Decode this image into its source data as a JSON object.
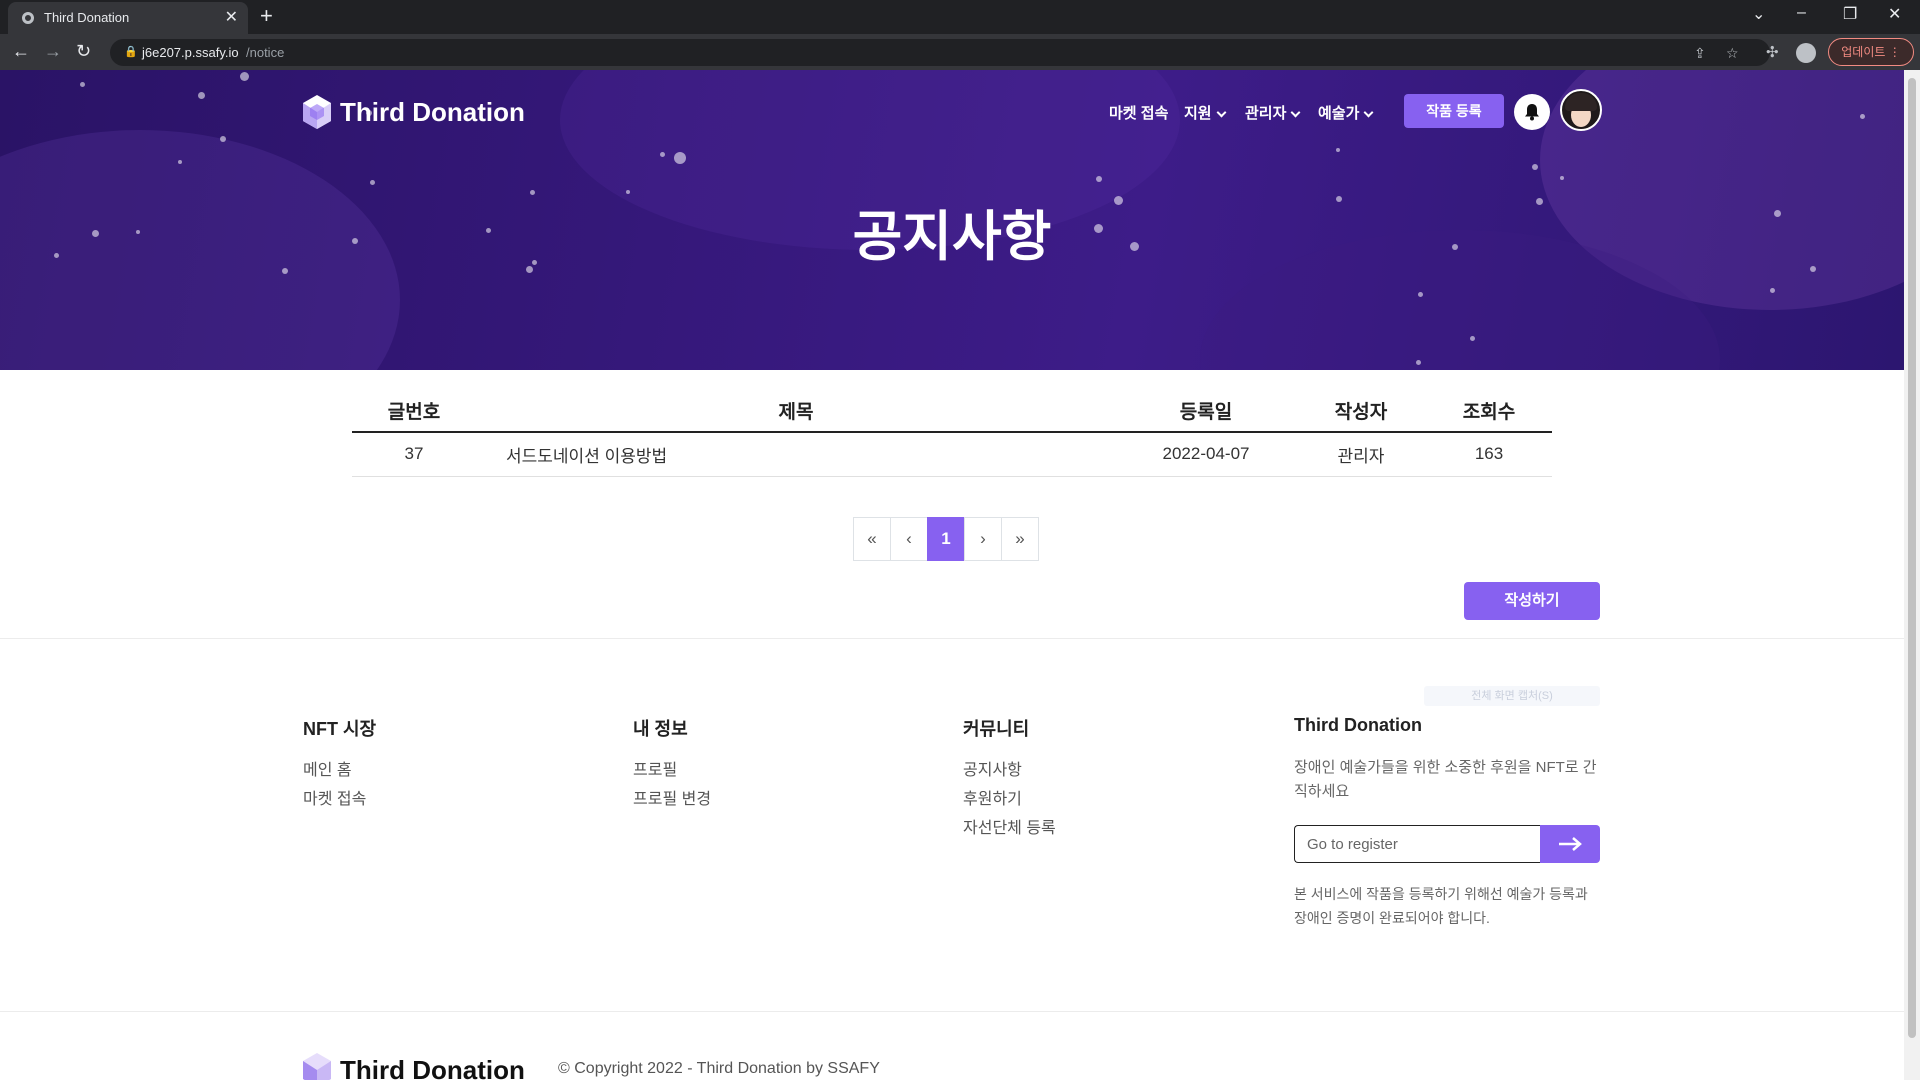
{
  "browser": {
    "tab_title": "Third Donation",
    "tab_close": "✕",
    "new_tab": "+",
    "url_host": "j6e207.p.ssafy.io",
    "url_path": "/notice",
    "update_label": "업데이트"
  },
  "header": {
    "logo_text": "Third Donation",
    "nav": {
      "market": "마켓 접속",
      "support": "지원",
      "admin": "관리자",
      "artist": "예술가"
    },
    "register_artwork": "작품 등록"
  },
  "hero": {
    "title": "공지사항"
  },
  "notice_table": {
    "headers": {
      "no": "글번호",
      "title": "제목",
      "date": "등록일",
      "author": "작성자",
      "views": "조회수"
    },
    "rows": [
      {
        "no": "37",
        "title": "서드도네이션 이용방법",
        "date": "2022-04-07",
        "author": "관리자",
        "views": "163"
      }
    ]
  },
  "pagination": {
    "first": "«",
    "prev": "‹",
    "current": "1",
    "next": "›",
    "last": "»"
  },
  "write_button": "작성하기",
  "footer": {
    "nft_market": {
      "heading": "NFT 시장",
      "links": [
        "메인 홈",
        "마켓 접속"
      ]
    },
    "my_info": {
      "heading": "내 정보",
      "links": [
        "프로필",
        "프로필 변경"
      ]
    },
    "community": {
      "heading": "커뮤니티",
      "links": [
        "공지사항",
        "후원하기",
        "자선단체 등록"
      ]
    },
    "about": {
      "heading": "Third Donation",
      "description": "장애인 예술가들을 위한 소중한 후원을 NFT로 간직하세요",
      "input_placeholder": "Go to register",
      "note": "본 서비스에 작품을 등록하기 위해선 예술가 등록과 장애인 증명이 완료되어야 합니다."
    },
    "faint_label": "전체 화면 캡처(S)",
    "bottom_logo": "Third Donation",
    "copyright": "© Copyright 2022 - Third Donation by SSAFY"
  },
  "colors": {
    "accent": "#8761f0",
    "hero_bg": "#35187a"
  }
}
